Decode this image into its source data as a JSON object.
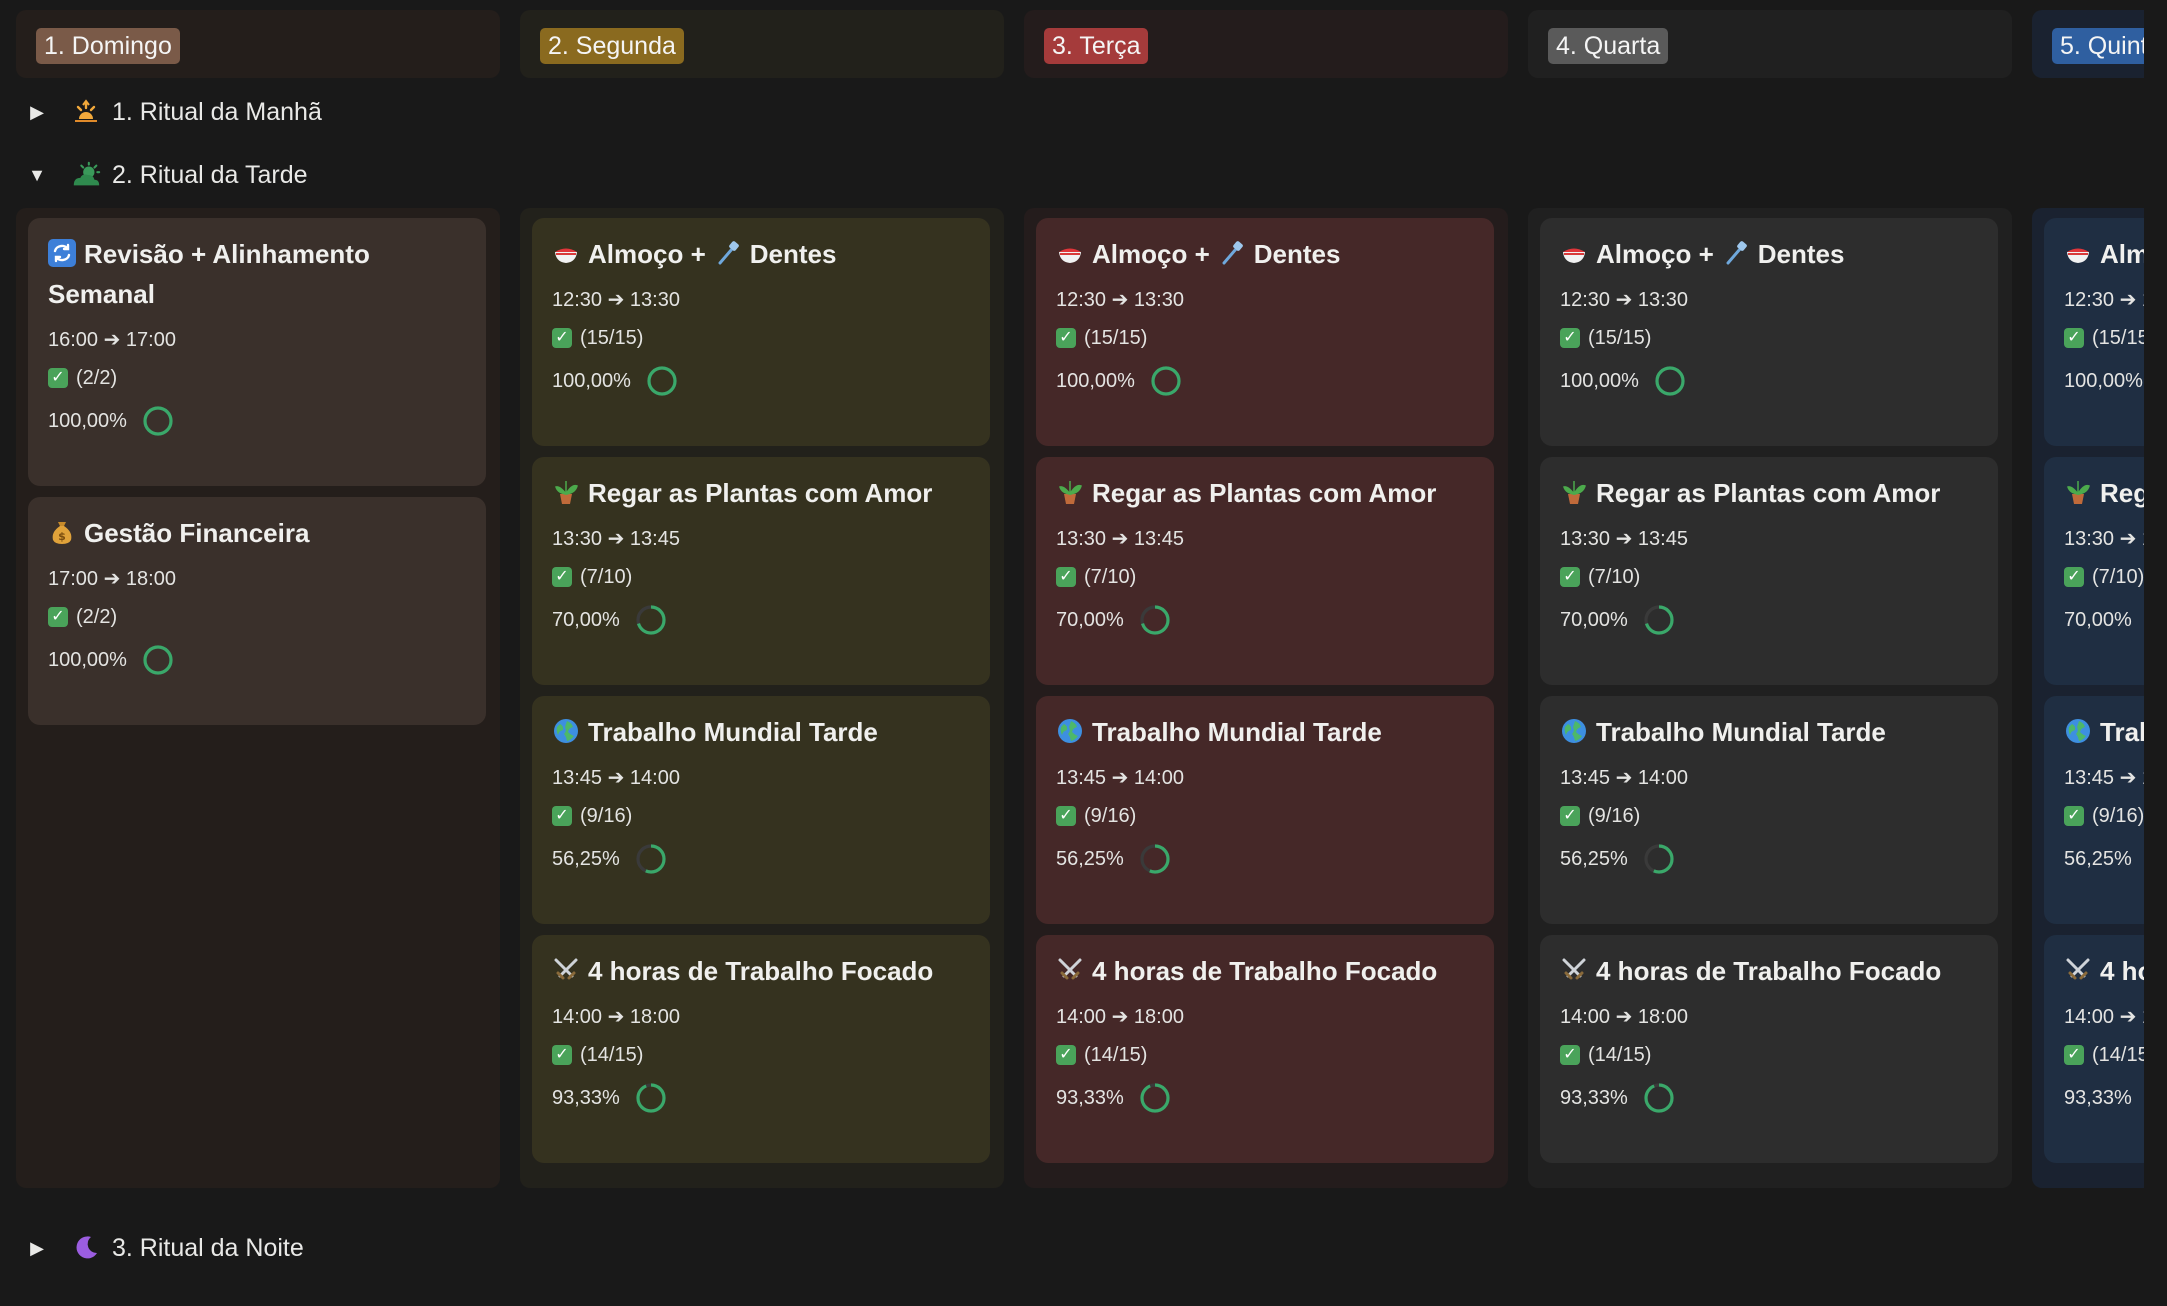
{
  "columns": [
    {
      "label": "1. Domingo",
      "tag_color": "#7a5a48",
      "bg": "#241e1b"
    },
    {
      "label": "2. Segunda",
      "tag_color": "#8a6a1f",
      "bg": "#22211b"
    },
    {
      "label": "3. Terça",
      "tag_color": "#a53b3b",
      "bg": "#241c1c"
    },
    {
      "label": "4. Quarta",
      "tag_color": "#5a5a5a",
      "bg": "#202020"
    },
    {
      "label": "5. Quint",
      "tag_color": "#2f5fa0",
      "bg": "#1a2230"
    }
  ],
  "groups": [
    {
      "label": "1. Ritual da Manhã",
      "icon": "sunrise-icon",
      "expanded": false
    },
    {
      "label": "2. Ritual da Tarde",
      "icon": "sun-cloud-icon",
      "expanded": true
    },
    {
      "label": "3. Ritual da Noite",
      "icon": "moon-icon",
      "expanded": false
    }
  ],
  "card_colors": {
    "domingo": "#3a302b",
    "segunda": "#35321f",
    "terca": "#452828",
    "quarta": "#2d2d2d",
    "quinta": "#1f2e42"
  },
  "cards": {
    "domingo": [
      {
        "icon": "repeat-icon",
        "title_a": "Revisão + Alinhamento",
        "title_b": "Semanal",
        "time": "16:00 ➔ 17:00",
        "check": "(2/2)",
        "pct": "100,00%",
        "progress": 1.0
      },
      {
        "icon": "money-bag-icon",
        "title_a": "Gestão Financeira",
        "time": "17:00 ➔ 18:00",
        "check": "(2/2)",
        "pct": "100,00%",
        "progress": 1.0
      }
    ],
    "weekday": [
      {
        "icon": "bowl-icon",
        "title_a": "Almoço +",
        "icon2": "toothbrush-icon",
        "title_b": "Dentes",
        "time": "12:30 ➔ 13:30",
        "check": "(15/15)",
        "pct": "100,00%",
        "progress": 1.0
      },
      {
        "icon": "potted-plant-icon",
        "title_a": "Regar as Plantas com Amor",
        "time": "13:30 ➔ 13:45",
        "check": "(7/10)",
        "pct": "70,00%",
        "progress": 0.7
      },
      {
        "icon": "globe-icon",
        "title_a": "Trabalho Mundial Tarde",
        "time": "13:45 ➔ 14:00",
        "check": "(9/16)",
        "pct": "56,25%",
        "progress": 0.5625
      },
      {
        "icon": "crossed-swords-icon",
        "title_a": "4 horas de Trabalho Focado",
        "time": "14:00 ➔ 18:00",
        "check": "(14/15)",
        "pct": "93,33%",
        "progress": 0.9333
      }
    ]
  },
  "check_glyph": "✓"
}
